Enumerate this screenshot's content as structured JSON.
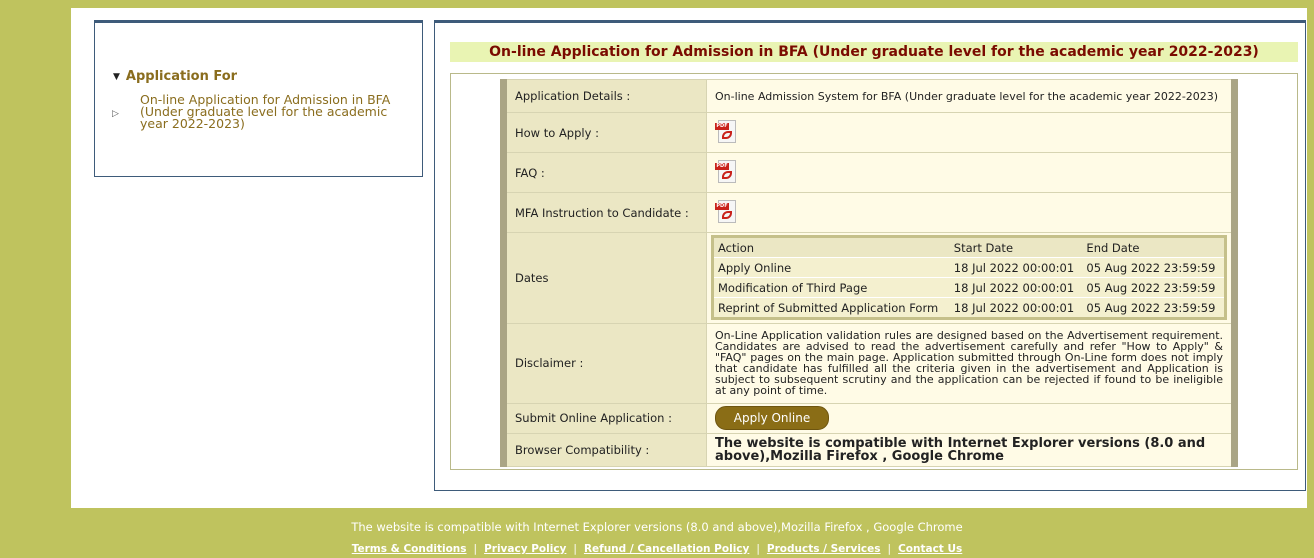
{
  "sidebar": {
    "heading": "Application For",
    "item": "On-line Application for Admission in BFA (Under graduate level for the academic year 2022-2023)"
  },
  "main": {
    "title": "On-line Application for Admission in BFA (Under graduate level for the academic year 2022-2023)",
    "rows": {
      "details_label": "Application Details :",
      "details_value": "On-line Admission System for BFA (Under graduate level for the academic year 2022-2023)",
      "how_label": "How to Apply :",
      "faq_label": "FAQ :",
      "mfa_label": "MFA Instruction to Candidate :",
      "dates_label": "Dates",
      "disclaimer_label": "Disclaimer :",
      "disclaimer_text": "On-Line Application validation rules are designed based on the Advertisement requirement. Candidates are advised to read the advertisement carefully and refer \"How to Apply\" & \"FAQ\" pages on the main page. Application submitted through On-Line form does not imply that candidate has fulfilled all the criteria given in the advertisement and Application is subject to subsequent scrutiny and the application can be rejected if found to be ineligible at any point of time.",
      "submit_label": "Submit Online Application :",
      "apply_button": "Apply Online",
      "browser_label": "Browser Compatibility :",
      "browser_value": "The website is compatible with Internet Explorer versions (8.0 and above),Mozilla Firefox , Google Chrome"
    },
    "dates": {
      "headers": [
        "Action",
        "Start Date",
        "End Date"
      ],
      "rows": [
        [
          "Apply Online",
          "18 Jul 2022 00:00:01",
          "05 Aug 2022 23:59:59"
        ],
        [
          "Modification of Third Page",
          "18 Jul 2022 00:00:01",
          "05 Aug 2022 23:59:59"
        ],
        [
          "Reprint of Submitted Application Form",
          "18 Jul 2022 00:00:01",
          "05 Aug 2022 23:59:59"
        ]
      ]
    },
    "pdf_icon_tag": "PDF"
  },
  "footer": {
    "compat": "The website is compatible with Internet Explorer versions (8.0 and above),Mozilla Firefox , Google Chrome",
    "links": [
      "Terms & Conditions",
      "Privacy Policy",
      "Refund / Cancellation Policy",
      "Products / Services",
      "Contact Us"
    ],
    "separator": "|"
  },
  "colors": {
    "olive_band": "#bfc35e",
    "title_text": "#7a0b00",
    "title_bg": "#e9f4b3",
    "accent_brown": "#8a6d16"
  }
}
